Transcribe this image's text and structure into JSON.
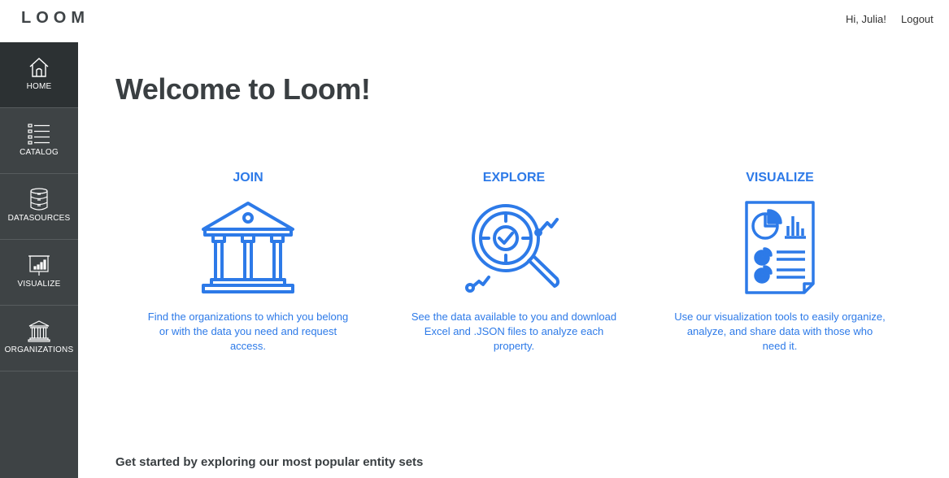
{
  "header": {
    "logo": "LOOM",
    "greeting": "Hi, Julia!",
    "logout": "Logout"
  },
  "sidebar": {
    "items": [
      {
        "label": "HOME",
        "icon": "home-icon",
        "active": true
      },
      {
        "label": "CATALOG",
        "icon": "catalog-list-icon"
      },
      {
        "label": "DATASOURCES",
        "icon": "database-icon"
      },
      {
        "label": "VISUALIZE",
        "icon": "chart-board-icon"
      },
      {
        "label": "ORGANIZATIONS",
        "icon": "institution-icon"
      }
    ]
  },
  "main": {
    "title": "Welcome to Loom!",
    "cards": [
      {
        "title": "JOIN",
        "icon": "institution-icon",
        "description": "Find the organizations to which you belong or with the data you need and request access."
      },
      {
        "title": "EXPLORE",
        "icon": "magnifier-chart-icon",
        "description": "See the data available to you and download Excel and .JSON files to analyze each property."
      },
      {
        "title": "VISUALIZE",
        "icon": "report-charts-icon",
        "description": "Use our visualization tools to easily organize, analyze, and share data with those who need it."
      }
    ],
    "subtitle": "Get started by exploring our most popular entity sets"
  },
  "colors": {
    "accent": "#2d7ae8",
    "sidebar": "#3e4345",
    "sidebar_active": "#2c3133",
    "title": "#3a3f42"
  }
}
